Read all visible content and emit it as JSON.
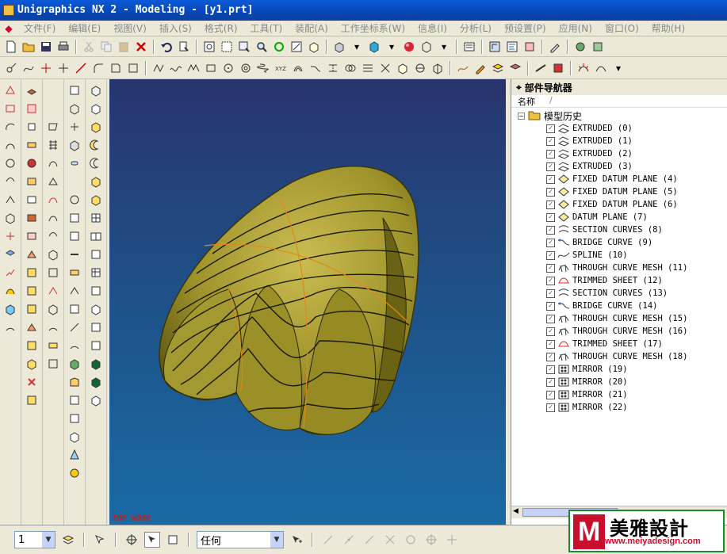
{
  "window": {
    "title": "Unigraphics NX 2 - Modeling - [y1.prt]"
  },
  "menu": [
    "文件(F)",
    "编辑(E)",
    "视图(V)",
    "插入(S)",
    "格式(R)",
    "工具(T)",
    "装配(A)",
    "工作坐标系(W)",
    "信息(I)",
    "分析(L)",
    "预设置(P)",
    "应用(N)",
    "窗口(O)",
    "帮助(H)"
  ],
  "viewport": {
    "label": "TOP WORK",
    "background": "#1f4f86",
    "model_color": "#a59a2e"
  },
  "navigator": {
    "title": "部件导航器",
    "column_name": "名称",
    "root": "模型历史",
    "features": [
      "EXTRUDED (0)",
      "EXTRUDED (1)",
      "EXTRUDED (2)",
      "EXTRUDED (3)",
      "FIXED DATUM PLANE (4)",
      "FIXED DATUM PLANE (5)",
      "FIXED DATUM PLANE (6)",
      "DATUM PLANE (7)",
      "SECTION CURVES (8)",
      "BRIDGE CURVE (9)",
      "SPLINE (10)",
      "THROUGH CURVE MESH (11)",
      "TRIMMED SHEET (12)",
      "SECTION CURVES (13)",
      "BRIDGE CURVE (14)",
      "THROUGH CURVE MESH (15)",
      "THROUGH CURVE MESH (16)",
      "TRIMMED SHEET (17)",
      "THROUGH CURVE MESH (18)",
      "MIRROR (19)",
      "MIRROR (20)",
      "MIRROR (21)",
      "MIRROR (22)"
    ]
  },
  "status": {
    "layer_value": "1",
    "filter_value": "任何"
  },
  "watermark": {
    "mark": "M",
    "name": "美雅設計",
    "url": "www.meiyadesign.com"
  }
}
